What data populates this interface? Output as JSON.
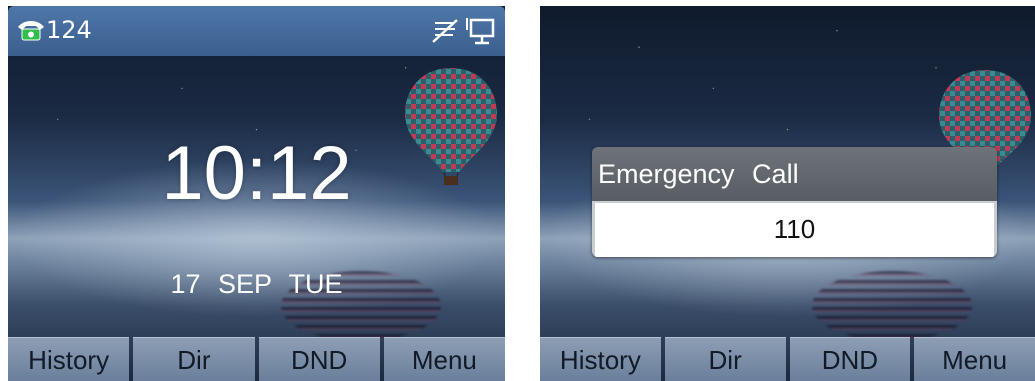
{
  "home_screen": {
    "status_bar": {
      "account": "124",
      "phone_icon": "phone-icon",
      "network_icon": "network-disconnected-icon",
      "pc_icon": "pc-port-icon"
    },
    "clock": "10:12",
    "date": "17 SEP TUE",
    "softkeys": [
      "History",
      "Dir",
      "DND",
      "Menu"
    ]
  },
  "emergency_screen": {
    "dialog": {
      "title": "Emergency Call",
      "number": "110"
    },
    "softkeys": [
      "History",
      "Dir",
      "DND",
      "Menu"
    ]
  },
  "colors": {
    "status_bar": "#4f77a8",
    "softkey": "#7a8ea9",
    "dialog_title": "#62676d"
  }
}
